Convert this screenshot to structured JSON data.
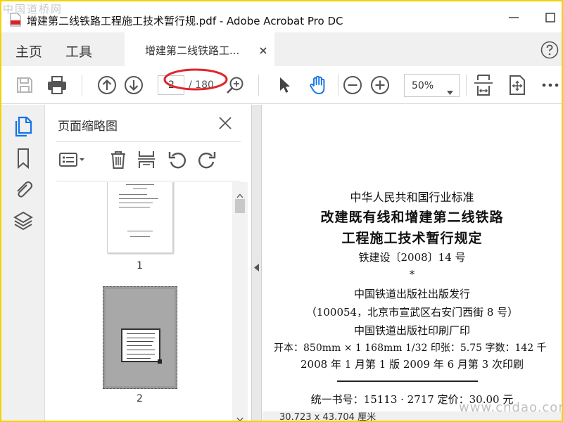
{
  "watermark_top": "中国道桥网",
  "watermark_bottom": "www.cndao.com",
  "window": {
    "title": "增建第二线铁路工程施工技术暂行规.pdf - Adobe Acrobat Pro DC"
  },
  "menu": {
    "home": "主页",
    "tools": "工具",
    "doc_tab": "增建第二线铁路工...",
    "help_icon": "help-icon"
  },
  "toolbar": {
    "page_current": "2",
    "page_total": "/ 180",
    "zoom": "50%",
    "icons": [
      "save-icon",
      "print-icon",
      "prev-page-icon",
      "next-page-icon",
      "find-icon",
      "select-arrow-icon",
      "hand-tool-icon",
      "zoom-out-icon",
      "zoom-in-icon",
      "fit-width-icon",
      "fit-page-icon",
      "more-icon"
    ],
    "annotation_color": "#e0262b"
  },
  "leftrail": {
    "icons": [
      "page-thumbnails-icon",
      "bookmarks-icon",
      "attachments-icon",
      "layers-icon"
    ],
    "active_color": "#1473e6"
  },
  "thumb_panel": {
    "title": "页面缩略图",
    "thumbnails": [
      {
        "label": "1"
      },
      {
        "label": "2"
      }
    ]
  },
  "document": {
    "standard": "中华人民共和国行业标准",
    "title_line1": "改建既有线和增建第二线铁路",
    "title_line2": "工程施工技术暂行规定",
    "doc_number": "铁建设〔2008〕14 号",
    "star": "*",
    "publisher": "中国铁道出版社出版发行",
    "address": "（100054，北京市宣武区右安门西街 8 号）",
    "printer": "中国铁道出版社印刷厂印",
    "specs": "开本：850mm × 1 168mm  1/32  印张：5.75  字数：142 千",
    "edition": "2008 年 1 月第 1 版  2009 年 6 月第 3 次印刷",
    "isbn": "统一书号：15113 · 2717   定价：30.00 元"
  },
  "status": {
    "page_size": "30.723 x 43.704 厘米"
  }
}
